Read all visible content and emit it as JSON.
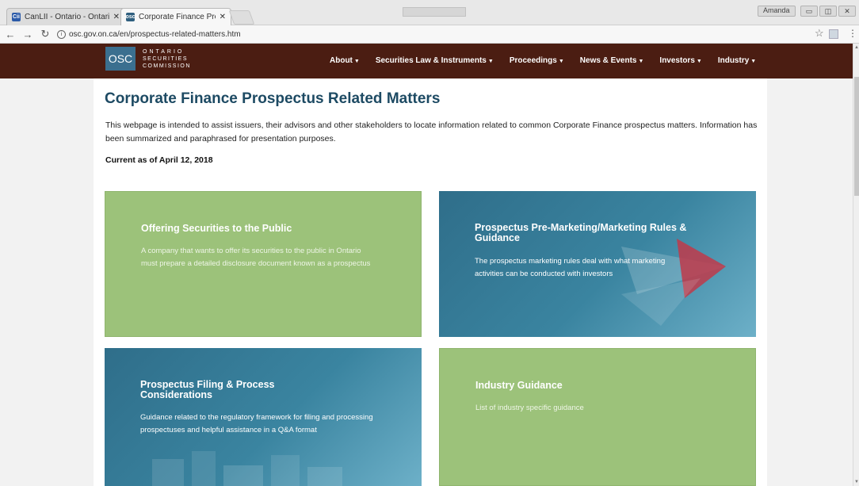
{
  "browser": {
    "tabs": [
      {
        "label": "CanLII - Ontario - Ontario",
        "favicon_text": "Cii",
        "favicon_color": "#2b5aa8",
        "active": false
      },
      {
        "label": "Corporate Finance Prosp",
        "favicon_text": "osc",
        "favicon_color": "#2f5f7f",
        "active": true
      }
    ],
    "profile_label": "Amanda",
    "url": "osc.gov.on.ca/en/prospectus-related-matters.htm"
  },
  "site": {
    "logo_abbr": "OSC",
    "logo_lines": [
      "ONTARIO",
      "SECURITIES",
      "COMMISSION"
    ],
    "nav": [
      {
        "label": "About"
      },
      {
        "label": "Securities Law & Instruments"
      },
      {
        "label": "Proceedings"
      },
      {
        "label": "News & Events"
      },
      {
        "label": "Investors"
      },
      {
        "label": "Industry"
      }
    ]
  },
  "page": {
    "title": "Corporate Finance Prospectus Related Matters",
    "intro": "This webpage is intended to assist issuers, their advisors and other stakeholders to locate information related to common Corporate Finance prospectus matters. Information has been summarized and paraphrased for presentation purposes.",
    "current_as_of": "Current as of April 12, 2018",
    "cards": [
      {
        "title": "Offering Securities to the Public",
        "description": "A company that wants to offer its securities to the public in Ontario must prepare a detailed disclosure document known as a prospectus"
      },
      {
        "title": "Prospectus Pre-Marketing/Marketing Rules & Guidance",
        "description": "The prospectus marketing rules deal with what marketing activities can be conducted with investors"
      },
      {
        "title": "Prospectus Filing & Process Considerations",
        "description": "Guidance related to the regulatory framework for filing and processing prospectuses and helpful assistance in a Q&A format"
      },
      {
        "title": "Industry Guidance",
        "description": "List of industry specific guidance"
      }
    ]
  },
  "colors": {
    "header_bg": "#4b1d12",
    "title_color": "#1d4a63",
    "card_green": "#9cc27a",
    "card_blue": "#2f6e8a"
  }
}
